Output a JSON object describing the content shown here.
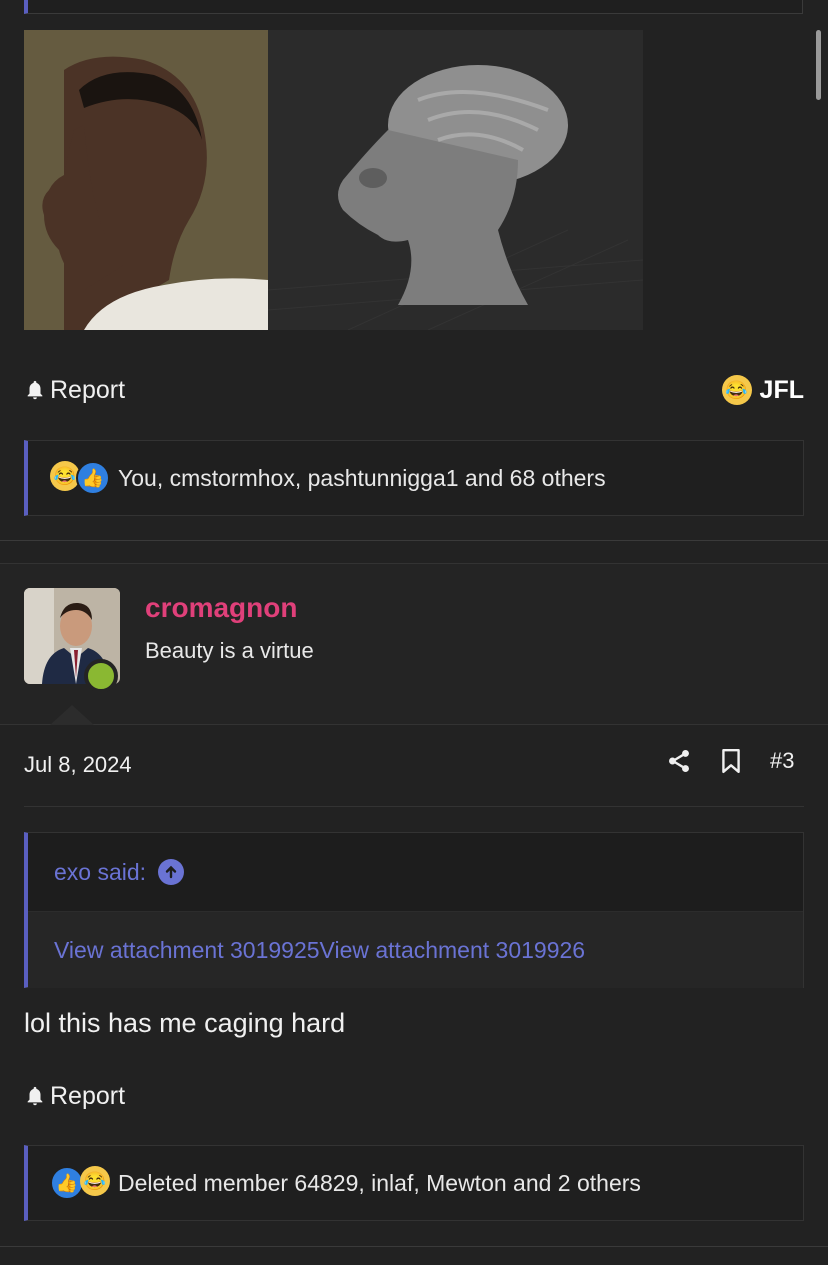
{
  "previous_post": {
    "report_label": "Report",
    "reaction_label": "JFL",
    "reactions_text": "You, cmstormhox, pashtunnigga1 and 68 others"
  },
  "post": {
    "username": "cromagnon",
    "user_title": "Beauty is a virtue",
    "date": "Jul 8, 2024",
    "post_number": "#3",
    "quote": {
      "author_label": "exo said:",
      "body": "View attachment 3019925View attachment 3019926"
    },
    "text": "lol this has me caging hard",
    "report_label": "Report",
    "reactions_text": "Deleted member 64829, inlaf, Mewton and 2 others"
  },
  "colors": {
    "background": "#222222",
    "accent": "#5a5fc0",
    "link": "#6a73d4",
    "username": "#e0407a",
    "online": "#8ab832"
  },
  "icons": [
    "bell-icon",
    "laughing-emoji-icon",
    "thumbs-up-icon",
    "share-icon",
    "bookmark-icon",
    "arrow-up-circle-icon"
  ]
}
